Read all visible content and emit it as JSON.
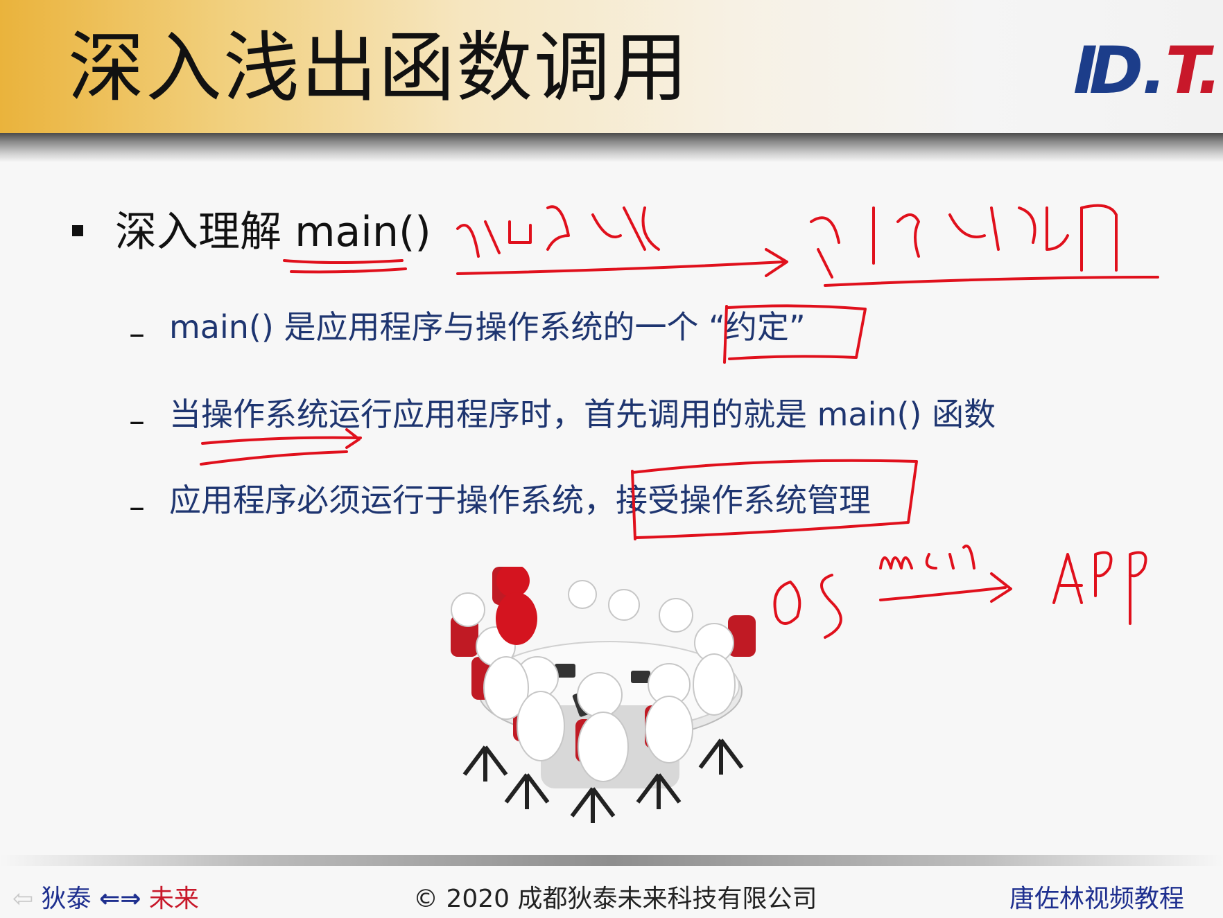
{
  "header": {
    "title": "深入浅出函数调用",
    "logo_main": "D.",
    "logo_t": "T.",
    "logo_bar": "I"
  },
  "content": {
    "main_point": "深入理解 main()",
    "sub_points": [
      "main() 是应用程序与操作系统的一个 “约定”",
      "当操作系统运行应用程序时，首先调用的就是 main() 函数",
      "应用程序必须运行于操作系统，接受操作系统管理"
    ],
    "dash": "–",
    "image_alt": "meeting-table-illustration"
  },
  "annotations": {
    "note1": "入口函数",
    "note2": "第1个被调用",
    "os": "OS",
    "main": "main",
    "app": "APP",
    "ink_color": "#e0101c"
  },
  "footer": {
    "left_a": "狄泰",
    "left_arrows": "⇐⇒",
    "left_b": "未来",
    "center": "© 2020 成都狄泰未来科技有限公司",
    "right": "唐佐林视频教程"
  }
}
